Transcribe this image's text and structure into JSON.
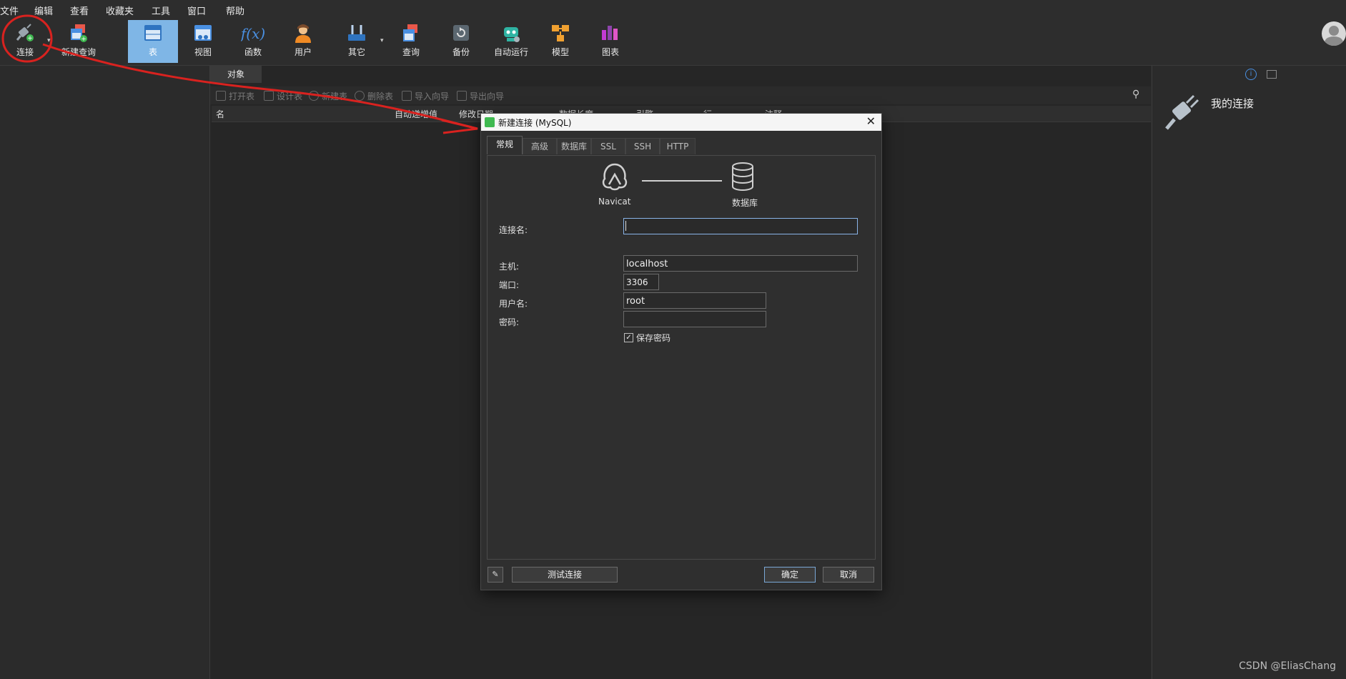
{
  "menu": [
    "文件",
    "编辑",
    "查看",
    "收藏夹",
    "工具",
    "窗口",
    "帮助"
  ],
  "toolbar": [
    {
      "label": "连接",
      "icon": "plug-connect-icon",
      "active": false
    },
    {
      "label": "新建查询",
      "icon": "new-query-icon",
      "active": false
    },
    {
      "label": "表",
      "icon": "table-icon",
      "active": true
    },
    {
      "label": "视图",
      "icon": "view-icon",
      "active": false
    },
    {
      "label": "函数",
      "icon": "function-icon",
      "active": false
    },
    {
      "label": "用户",
      "icon": "user-icon",
      "active": false
    },
    {
      "label": "其它",
      "icon": "tools-icon",
      "active": false
    },
    {
      "label": "查询",
      "icon": "query-icon",
      "active": false
    },
    {
      "label": "备份",
      "icon": "backup-icon",
      "active": false
    },
    {
      "label": "自动运行",
      "icon": "robot-icon",
      "active": false
    },
    {
      "label": "模型",
      "icon": "model-icon",
      "active": false
    },
    {
      "label": "图表",
      "icon": "chart-icon",
      "active": false
    }
  ],
  "objects_tab": "对象",
  "object_toolbar": [
    "打开表",
    "设计表",
    "新建表",
    "删除表",
    "导入向导",
    "导出向导"
  ],
  "columns": [
    "名",
    "自动递增值",
    "修改日期",
    "数据长度",
    "引擎",
    "行",
    "注释"
  ],
  "right_panel": {
    "title": "我的连接"
  },
  "dialog": {
    "title": "新建连接 (MySQL)",
    "tabs": [
      "常规",
      "高级",
      "数据库",
      "SSL",
      "SSH",
      "HTTP"
    ],
    "diagram_left": "Navicat",
    "diagram_right": "数据库",
    "fields": {
      "conn_name_label": "连接名:",
      "conn_name_value": "",
      "host_label": "主机:",
      "host_value": "localhost",
      "port_label": "端口:",
      "port_value": "3306",
      "user_label": "用户名:",
      "user_value": "root",
      "password_label": "密码:",
      "password_value": ""
    },
    "save_password": {
      "label": "保存密码",
      "checked": true
    },
    "buttons": {
      "test": "测试连接",
      "ok": "确定",
      "cancel": "取消"
    }
  },
  "watermark": "CSDN @EliasChang",
  "colors": {
    "annotation": "#d9221f",
    "active_tab": "#7fb6e6"
  }
}
